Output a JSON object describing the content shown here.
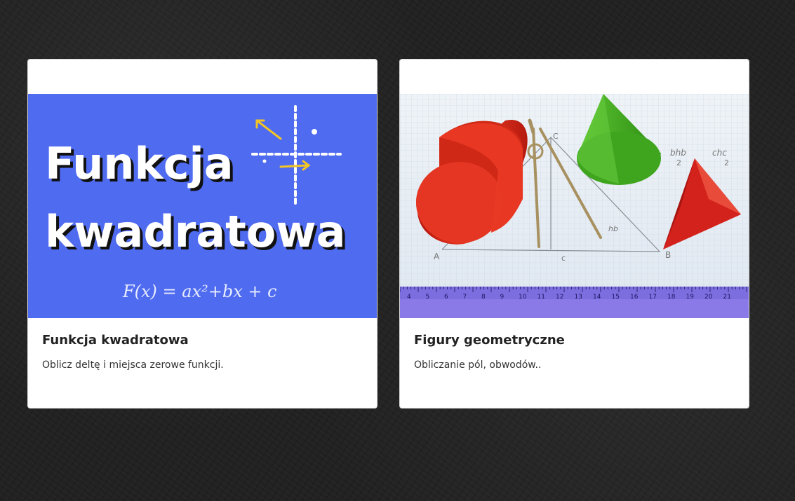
{
  "cards": [
    {
      "title": "Funkcja kwadratowa",
      "description": "Oblicz deltę i miejsca zerowe funkcji.",
      "image": {
        "headline_line1": "Funkcja",
        "headline_line2": "kwadratowa",
        "formula": "F(x) = ax²+bx + c",
        "background_color": "#4f6bf0"
      }
    },
    {
      "title": "Figury geometryczne",
      "description": "Obliczanie pól, obwodów..",
      "image": {
        "labels": [
          "A",
          "B",
          "C",
          "c",
          "hb",
          "bhb",
          "2",
          "chc",
          "2"
        ],
        "ruler_numbers": [
          "4",
          "5",
          "6",
          "7",
          "8",
          "9",
          "10",
          "11",
          "12",
          "13",
          "14",
          "15",
          "16",
          "17",
          "18",
          "19",
          "20",
          "21"
        ]
      }
    }
  ],
  "colors": {
    "page_background": "#222222",
    "card_background": "#ffffff",
    "cylinder": "#e02a1a",
    "cone": "#3ea51c",
    "pyramid": "#d3211c",
    "ruler": "#8a7ae8"
  }
}
